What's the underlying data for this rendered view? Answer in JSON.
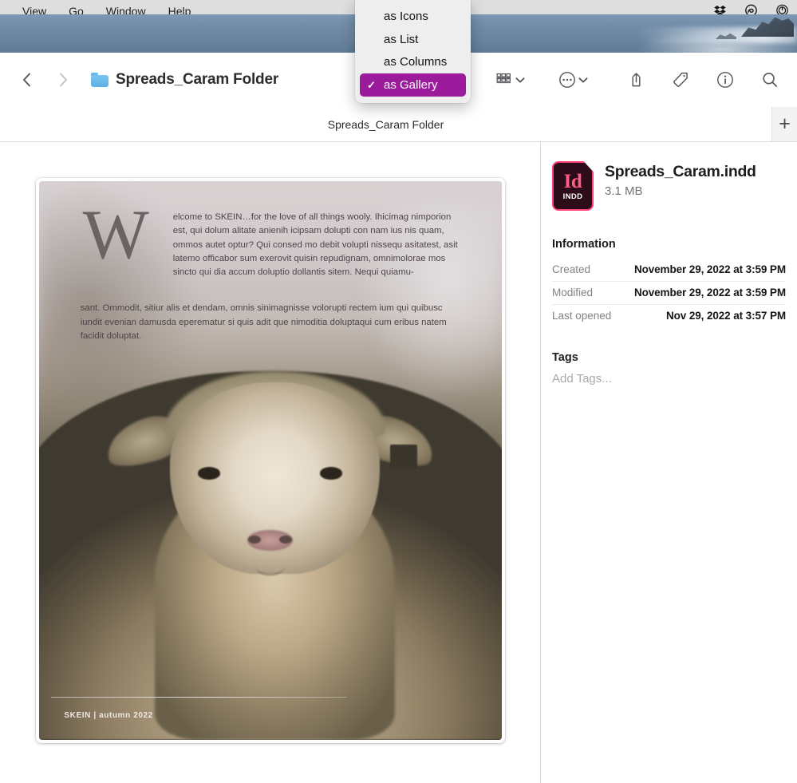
{
  "menubar": {
    "items": [
      {
        "label": "View"
      },
      {
        "label": "Go"
      },
      {
        "label": "Window"
      },
      {
        "label": "Help"
      }
    ],
    "status_icons": [
      {
        "name": "dropbox-icon"
      },
      {
        "name": "creative-cloud-icon"
      },
      {
        "name": "power-control-icon"
      }
    ]
  },
  "view_menu": {
    "items": [
      {
        "label": "as Icons",
        "checked": false
      },
      {
        "label": "as List",
        "checked": false
      },
      {
        "label": "as Columns",
        "checked": false
      },
      {
        "label": "as Gallery",
        "checked": true
      }
    ],
    "check_glyph": "✓",
    "highlight_color": "#9c1a9c"
  },
  "toolbar": {
    "back_label": "Back",
    "forward_label": "Forward",
    "folder_title": "Spreads_Caram Folder",
    "view_options_label": "View options",
    "actions_label": "Actions",
    "share_label": "Share",
    "tags_label": "Tags",
    "info_label": "Get Info",
    "search_label": "Search"
  },
  "tabbar": {
    "active_tab": "Spreads_Caram Folder",
    "new_tab_glyph": "+"
  },
  "preview": {
    "dropcap": "W",
    "body": "elcome to SKEIN…for the love of all things wooly. Ihicimag nimporion est, qui dolum alitate anienih icipsam dolupti con nam ius nis quam, ommos autet optur? Qui consed mo debit volupti nissequ asitatest, asit latemo officabor sum exerovit quisin repudignam, omnimolorae mos sincto qui dia accum doluptio dollantis sitem. Nequi quiamu-",
    "body_tail": "sant. Ommodit, sitiur alis et dendam, omnis sinimagnisse volorupti rectem ium qui quibusc iundit evenian damusda eperematur si quis adit que nimoditia doluptaqui cum eribus natem facidit doluptat.",
    "caption": "SKEIN  |  autumn 2022"
  },
  "info": {
    "file_name": "Spreads_Caram.indd",
    "file_size": "3.1 MB",
    "icon_app": "Id",
    "icon_ext": "INDD",
    "information_heading": "Information",
    "rows": [
      {
        "key": "Created",
        "value": "November 29, 2022 at 3:59 PM"
      },
      {
        "key": "Modified",
        "value": "November 29, 2022 at 3:59 PM"
      },
      {
        "key": "Last opened",
        "value": "Nov 29, 2022 at 3:57 PM"
      }
    ],
    "tags_heading": "Tags",
    "add_tags_placeholder": "Add Tags..."
  }
}
